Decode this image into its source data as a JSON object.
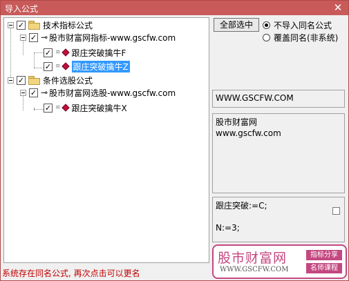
{
  "window": {
    "title": "导入公式",
    "close_glyph": "✕"
  },
  "tree": {
    "groups": [
      {
        "label": "技术指标公式",
        "publisher": "股市财富网指标-www.gscfw.com",
        "items": [
          {
            "label": "跟庄突破擒牛F",
            "selected": false
          },
          {
            "label": "跟庄突破擒牛Z",
            "selected": true
          }
        ]
      },
      {
        "label": "条件选股公式",
        "publisher": "股市财富网选股-www.gscfw.com",
        "items": [
          {
            "label": "跟庄突破擒牛X",
            "selected": false
          }
        ]
      }
    ]
  },
  "controls": {
    "select_all_label": "全部选中",
    "radio_no_import_label": "不导入同名公式",
    "radio_overwrite_label": "覆盖同名(非系统)",
    "check_glyph": "✓"
  },
  "info": {
    "url_text": "WWW.GSCFW.COM",
    "desc_line1": "股市财富网",
    "desc_line2": "www.gscfw.com",
    "code_line1": "跟庄突破:=C;",
    "code_line2": "N:=3;"
  },
  "status": {
    "message": "系统存在同名公式, 再次点击可以更名"
  },
  "watermark": {
    "name": "股市财富网",
    "url": "WWW.GSCFW.COM",
    "tag1": "指标分享",
    "tag2": "名师课程"
  },
  "colors": {
    "title_bar": "#c85a5a",
    "status_text": "#c00000",
    "watermark": "#c44780",
    "selection": "#3399ff"
  },
  "icons": [
    "close-icon",
    "folder-icon",
    "key-icon",
    "formula-gem-icon",
    "checkbox-checked-icon"
  ]
}
